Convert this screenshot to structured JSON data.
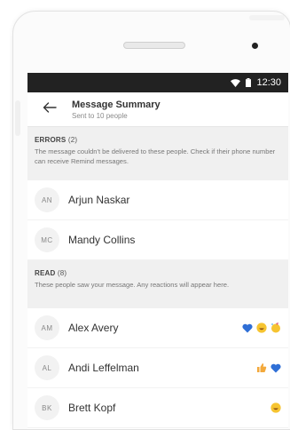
{
  "status_bar": {
    "time": "12:30"
  },
  "header": {
    "title": "Message Summary",
    "subtitle": "Sent to 10 people"
  },
  "errors": {
    "label": "ERRORS",
    "count": "(2)",
    "description": "The message couldn't be delivered to these people. Check if their phone number can receive Remind messages.",
    "people": [
      {
        "initials": "AN",
        "name": "Arjun Naskar"
      },
      {
        "initials": "MC",
        "name": "Mandy Collins"
      }
    ]
  },
  "read": {
    "label": "READ",
    "count": "(8)",
    "description": "These people saw your message. Any reactions will appear here.",
    "people": [
      {
        "initials": "AM",
        "name": "Alex Avery",
        "reactions": [
          "blue-heart",
          "grinning-face",
          "party-face"
        ]
      },
      {
        "initials": "AL",
        "name": "Andi Leffelman",
        "reactions": [
          "thumbs-up",
          "blue-heart"
        ]
      },
      {
        "initials": "BK",
        "name": "Brett Kopf",
        "reactions": [
          "grinning-face"
        ]
      }
    ]
  },
  "colors": {
    "heart": "#2f6fd6",
    "emoji": "#f6c431",
    "statusbar": "#222222"
  }
}
